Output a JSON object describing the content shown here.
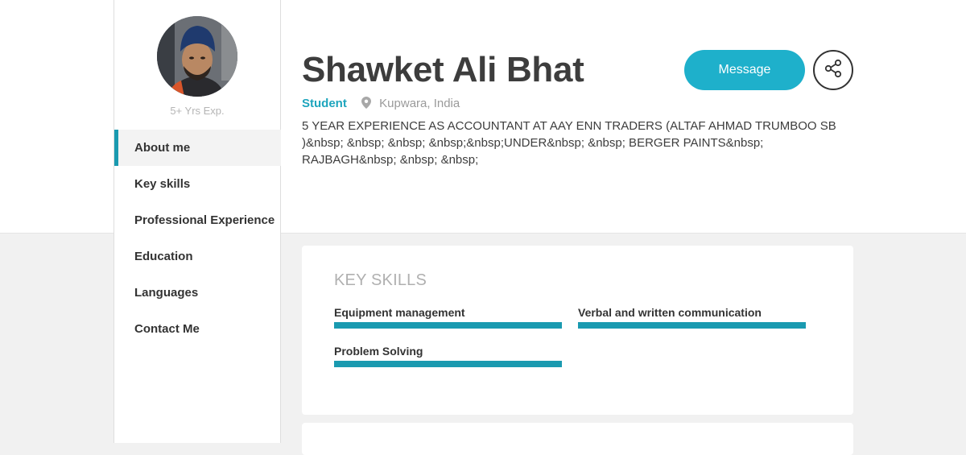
{
  "profile": {
    "name": "Shawket Ali Bhat",
    "experience": "5+ Yrs Exp.",
    "role": "Student",
    "location": "Kupwara, India",
    "bio": "5 YEAR EXPERIENCE AS ACCOUNTANT AT AAY ENN TRADERS (ALTAF AHMAD TRUMBOO SB )&nbsp; &nbsp; &nbsp; &nbsp;&nbsp;UNDER&nbsp; &nbsp; BERGER PAINTS&nbsp; RAJBAGH&nbsp; &nbsp; &nbsp;"
  },
  "actions": {
    "message_label": "Message",
    "share_icon": "share-icon"
  },
  "nav": {
    "items": [
      {
        "label": "About me",
        "active": true
      },
      {
        "label": "Key skills",
        "active": false
      },
      {
        "label": "Professional Experience",
        "active": false
      },
      {
        "label": "Education",
        "active": false
      },
      {
        "label": "Languages",
        "active": false
      },
      {
        "label": "Contact Me",
        "active": false
      }
    ]
  },
  "skills": {
    "title": "KEY SKILLS",
    "items": [
      {
        "name": "Equipment management",
        "level": 1.0
      },
      {
        "name": "Verbal and written communication",
        "level": 1.0
      },
      {
        "name": "Problem Solving",
        "level": 1.0
      }
    ]
  },
  "colors": {
    "accent": "#1eb0cb",
    "nav_indicator": "#1a9ab0",
    "skill_bar": "#1a9ab0"
  }
}
